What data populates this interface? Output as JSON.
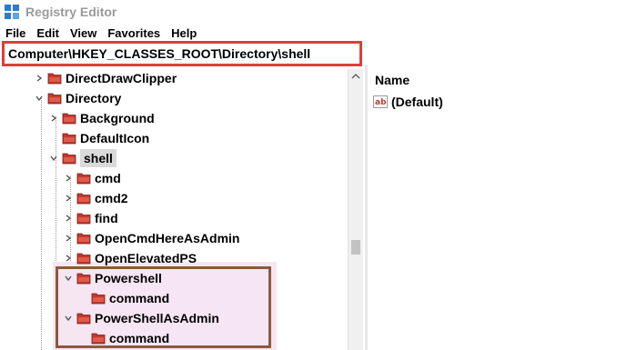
{
  "window": {
    "title": "Registry Editor"
  },
  "menu": {
    "items": [
      "File",
      "Edit",
      "View",
      "Favorites",
      "Help"
    ]
  },
  "address": {
    "path": "Computer\\HKEY_CLASSES_ROOT\\Directory\\shell"
  },
  "tree": {
    "nodes": [
      {
        "label": "DirectDrawClipper",
        "expanded": false
      },
      {
        "label": "Directory",
        "expanded": true
      },
      {
        "label": "Background",
        "expanded": false
      },
      {
        "label": "DefaultIcon",
        "expanded": false
      },
      {
        "label": "shell",
        "expanded": true,
        "selected": true
      },
      {
        "label": "cmd",
        "expanded": false
      },
      {
        "label": "cmd2",
        "expanded": false
      },
      {
        "label": "find",
        "expanded": false
      },
      {
        "label": "OpenCmdHereAsAdmin",
        "expanded": false
      },
      {
        "label": "OpenElevatedPS",
        "expanded": false
      },
      {
        "label": "Powershell",
        "expanded": true
      },
      {
        "label": "command",
        "expanded": false
      },
      {
        "label": "PowerShellAsAdmin",
        "expanded": true
      },
      {
        "label": "command",
        "expanded": false
      }
    ]
  },
  "values_pane": {
    "column_name": "Name",
    "rows": [
      {
        "name": "(Default)",
        "icon": "ab-string-icon"
      }
    ]
  },
  "colors": {
    "address_highlight": "#e23c3c",
    "tree_highlight": "#8b5a3c",
    "folder_red": "#c0392b"
  }
}
